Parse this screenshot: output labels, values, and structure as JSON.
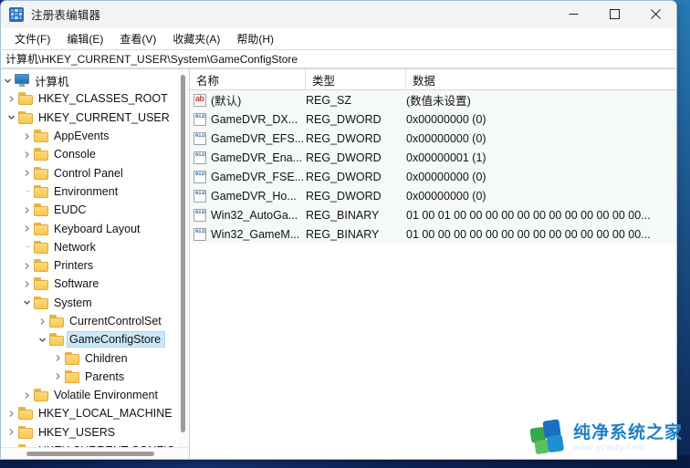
{
  "window": {
    "title": "注册表编辑器",
    "icon": "registry-grid-icon",
    "controls": {
      "minimize": "—",
      "maximize": "□",
      "close": "✕"
    }
  },
  "menu": {
    "items": [
      {
        "label": "文件(F)",
        "name": "menu-file"
      },
      {
        "label": "编辑(E)",
        "name": "menu-edit"
      },
      {
        "label": "查看(V)",
        "name": "menu-view"
      },
      {
        "label": "收藏夹(A)",
        "name": "menu-favorites"
      },
      {
        "label": "帮助(H)",
        "name": "menu-help"
      }
    ]
  },
  "address_bar": {
    "path": "计算机\\HKEY_CURRENT_USER\\System\\GameConfigStore"
  },
  "tree": {
    "root_label": "计算机",
    "nodes": [
      {
        "label": "HKEY_CLASSES_ROOT",
        "depth": 1,
        "state": "collapsed",
        "selected": false
      },
      {
        "label": "HKEY_CURRENT_USER",
        "depth": 1,
        "state": "expanded",
        "selected": false
      },
      {
        "label": "AppEvents",
        "depth": 2,
        "state": "collapsed",
        "selected": false
      },
      {
        "label": "Console",
        "depth": 2,
        "state": "collapsed",
        "selected": false
      },
      {
        "label": "Control Panel",
        "depth": 2,
        "state": "collapsed",
        "selected": false
      },
      {
        "label": "Environment",
        "depth": 2,
        "state": "leaf",
        "selected": false
      },
      {
        "label": "EUDC",
        "depth": 2,
        "state": "collapsed",
        "selected": false
      },
      {
        "label": "Keyboard Layout",
        "depth": 2,
        "state": "collapsed",
        "selected": false
      },
      {
        "label": "Network",
        "depth": 2,
        "state": "leaf",
        "selected": false
      },
      {
        "label": "Printers",
        "depth": 2,
        "state": "collapsed",
        "selected": false
      },
      {
        "label": "Software",
        "depth": 2,
        "state": "collapsed",
        "selected": false
      },
      {
        "label": "System",
        "depth": 2,
        "state": "expanded",
        "selected": false
      },
      {
        "label": "CurrentControlSet",
        "depth": 3,
        "state": "collapsed",
        "selected": false
      },
      {
        "label": "GameConfigStore",
        "depth": 3,
        "state": "expanded",
        "selected": true
      },
      {
        "label": "Children",
        "depth": 4,
        "state": "collapsed",
        "selected": false
      },
      {
        "label": "Parents",
        "depth": 4,
        "state": "collapsed",
        "selected": false
      },
      {
        "label": "Volatile Environment",
        "depth": 2,
        "state": "collapsed",
        "selected": false
      },
      {
        "label": "HKEY_LOCAL_MACHINE",
        "depth": 1,
        "state": "collapsed",
        "selected": false
      },
      {
        "label": "HKEY_USERS",
        "depth": 1,
        "state": "collapsed",
        "selected": false
      },
      {
        "label": "HKEY CURRENT CONFIG",
        "depth": 1,
        "state": "collapsed",
        "selected": false
      }
    ]
  },
  "values": {
    "columns": [
      {
        "label": "名称",
        "name": "column-name"
      },
      {
        "label": "类型",
        "name": "column-type"
      },
      {
        "label": "数据",
        "name": "column-data"
      }
    ],
    "rows": [
      {
        "icon": "string-value-icon",
        "name": "(默认)",
        "type": "REG_SZ",
        "data": "(数值未设置)"
      },
      {
        "icon": "dword-value-icon",
        "name": "GameDVR_DX...",
        "type": "REG_DWORD",
        "data": "0x00000000 (0)"
      },
      {
        "icon": "dword-value-icon",
        "name": "GameDVR_EFS...",
        "type": "REG_DWORD",
        "data": "0x00000000 (0)"
      },
      {
        "icon": "dword-value-icon",
        "name": "GameDVR_Ena...",
        "type": "REG_DWORD",
        "data": "0x00000001 (1)"
      },
      {
        "icon": "dword-value-icon",
        "name": "GameDVR_FSE...",
        "type": "REG_DWORD",
        "data": "0x00000000 (0)"
      },
      {
        "icon": "dword-value-icon",
        "name": "GameDVR_Ho...",
        "type": "REG_DWORD",
        "data": "0x00000000 (0)"
      },
      {
        "icon": "binary-value-icon",
        "name": "Win32_AutoGa...",
        "type": "REG_BINARY",
        "data": "01 00 01 00 00 00 00 00 00 00 00 00 00 00 00..."
      },
      {
        "icon": "binary-value-icon",
        "name": "Win32_GameM...",
        "type": "REG_BINARY",
        "data": "01 00 00 00 00 00 00 00 00 00 00 00 00 00 00..."
      }
    ]
  },
  "watermark": {
    "main_text": "纯净系统之家",
    "sub_text": "www.ycwjzy.com"
  },
  "colors": {
    "selection": "#cce8f7",
    "folder": "#f8c851",
    "accent": "#2b6cb8",
    "row_background": "#f6faf6"
  }
}
